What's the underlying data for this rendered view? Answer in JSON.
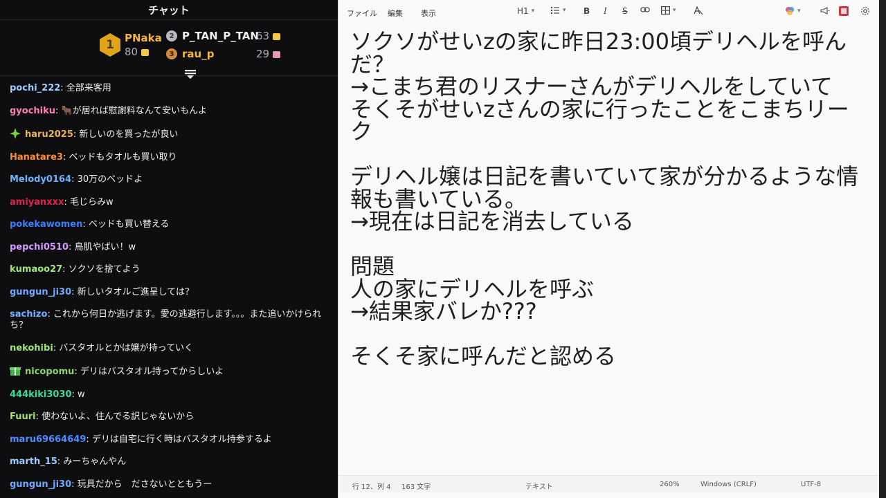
{
  "chat": {
    "title": "チャット",
    "leaderboard": {
      "first": {
        "rank": "1",
        "name": "PNaka",
        "value": "80"
      },
      "second": {
        "rank": "2",
        "name": "P_TAN_P_TAN",
        "value": "63"
      },
      "third": {
        "rank": "3",
        "name": "rau_p",
        "value": "29"
      }
    },
    "messages": [
      {
        "user": "pochi_222",
        "color": "#9ecbff",
        "text": ": 全部来客用"
      },
      {
        "user": "gyochiku",
        "color": "#ff7fb0",
        "text": ": 🐂が居れば慰謝料なんて安いもんよ"
      },
      {
        "user": "haru2025",
        "color": "#e6b55b",
        "text": ": 新しいのを買ったが良い",
        "badge": "sparkle"
      },
      {
        "user": "Hanatare3",
        "color": "#ff8c2b",
        "text": ": ベッドもタオルも買い取り"
      },
      {
        "user": "Melody0164",
        "color": "#6fb3ff",
        "text": ": 30万のベッドよ"
      },
      {
        "user": "amiyanxxx",
        "color": "#e0244f",
        "text": ": 毛じらみw"
      },
      {
        "user": "pokekawomen",
        "color": "#3a7dff",
        "text": ": ベッドも買い替える"
      },
      {
        "user": "pepchi0510",
        "color": "#d49bff",
        "text": ": 鳥肌やばい！w"
      },
      {
        "user": "kumaoo27",
        "color": "#9ee87a",
        "text": ": ソクソを捨てよう"
      },
      {
        "user": "gungun_ji30",
        "color": "#6fa8ff",
        "text": ": 新しいタオルご進呈しては？"
      },
      {
        "user": "sachizo",
        "color": "#6fb3ff",
        "text": ": これから何日か逃げます。愛の逃避行します。。。また追いかけられ ち？",
        "wrap": true
      },
      {
        "user": "nekohibi",
        "color": "#9ee87a",
        "text": ": バスタオルとかは嬢が持っていく"
      },
      {
        "user": "nicopomu",
        "color": "#8fd16a",
        "text": ": デリはバスタオル持ってからしいよ",
        "badge": "gift"
      },
      {
        "user": "444kiki3030",
        "color": "#3ddb9a",
        "text": ": w"
      },
      {
        "user": "Fuuri",
        "color": "#a8e06a",
        "text": ": 使わないよ、住んでる訳じゃないから"
      },
      {
        "user": "maru69664649",
        "color": "#4d8dff",
        "text": ": デリは自宅に行く時はバスタオル持参するよ"
      },
      {
        "user": "marth_15",
        "color": "#9ecbff",
        "text": ": みーちゃんやん"
      },
      {
        "user": "gungun_ji30",
        "color": "#6fa8ff",
        "text": ": 玩具だから　ださないとともうー"
      }
    ]
  },
  "notepad": {
    "menu": {
      "file": "ファイル",
      "edit": "編集",
      "view": "表示"
    },
    "toolbar": {
      "heading": "H1"
    },
    "lines": [
      "ソクソがせいzの家に昨日23:00頃デリヘルを呼ん",
      "だ？",
      "→こまち君のリスナーさんがデリヘルをしていて",
      "そくそがせいzさんの家に行ったことをこまちリー",
      "ク",
      "",
      "デリヘル嬢は日記を書いていて家が分かるような情",
      "報も書いている。",
      "→現在は日記を消去している",
      "",
      "問題",
      "人の家にデリヘルを呼ぶ",
      "→結果家バレか???",
      "",
      "そくそ家に呼んだと認める"
    ],
    "status": {
      "position": "行 12、列 4",
      "chars": "163 文字",
      "format": "テキスト",
      "zoom": "260%",
      "line_ending": "Windows (CRLF)",
      "encoding": "UTF-8"
    }
  }
}
